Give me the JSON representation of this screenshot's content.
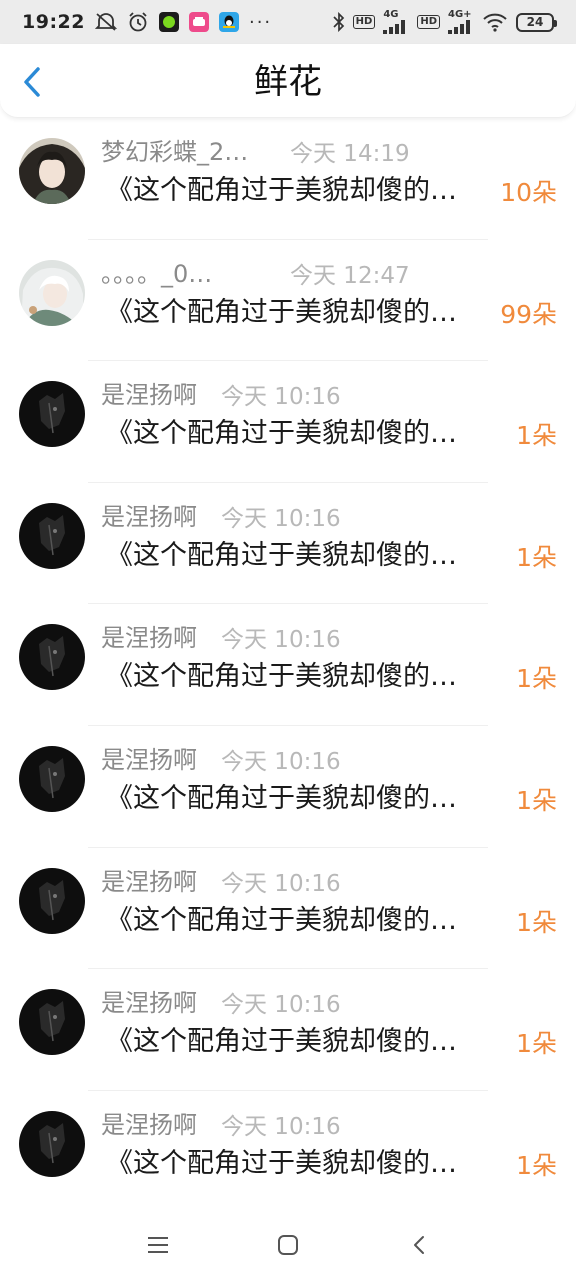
{
  "status_bar": {
    "time": "19:22",
    "more": "···",
    "hd_label": "HD",
    "net_label_1": "4G",
    "net_label_2": "4G+",
    "battery": "24"
  },
  "header": {
    "title": "鲜花"
  },
  "items": [
    {
      "name": "梦幻彩蝶_2…",
      "time": "今天 14:19",
      "message": "《这个配角过于美貌却傻的…",
      "flowers": "10朵",
      "avatar": "avatar-anime-dark-hair"
    },
    {
      "name": "。。。。_0…",
      "time": "今天 12:47",
      "message": "《这个配角过于美貌却傻的…",
      "flowers": "99朵",
      "avatar": "avatar-anime-white-hair"
    },
    {
      "name": "是涅扬啊",
      "time": "今天 10:16",
      "message": "《这个配角过于美貌却傻的…",
      "flowers": "1朵",
      "avatar": "avatar-dark"
    },
    {
      "name": "是涅扬啊",
      "time": "今天 10:16",
      "message": "《这个配角过于美貌却傻的…",
      "flowers": "1朵",
      "avatar": "avatar-dark"
    },
    {
      "name": "是涅扬啊",
      "time": "今天 10:16",
      "message": "《这个配角过于美貌却傻的…",
      "flowers": "1朵",
      "avatar": "avatar-dark"
    },
    {
      "name": "是涅扬啊",
      "time": "今天 10:16",
      "message": "《这个配角过于美貌却傻的…",
      "flowers": "1朵",
      "avatar": "avatar-dark"
    },
    {
      "name": "是涅扬啊",
      "time": "今天 10:16",
      "message": "《这个配角过于美貌却傻的…",
      "flowers": "1朵",
      "avatar": "avatar-dark"
    },
    {
      "name": "是涅扬啊",
      "time": "今天 10:16",
      "message": "《这个配角过于美貌却傻的…",
      "flowers": "1朵",
      "avatar": "avatar-dark"
    },
    {
      "name": "是涅扬啊",
      "time": "今天 10:16",
      "message": "《这个配角过于美貌却傻的…",
      "flowers": "1朵",
      "avatar": "avatar-dark"
    }
  ],
  "nav": {
    "menu_icon": "menu-icon",
    "home_icon": "home-icon",
    "back_icon": "back-icon"
  },
  "colors": {
    "accent": "#2b8ad6",
    "flower_count": "#f08a3c",
    "muted_text": "#8a8a8a",
    "time_text": "#b8b8b8"
  }
}
